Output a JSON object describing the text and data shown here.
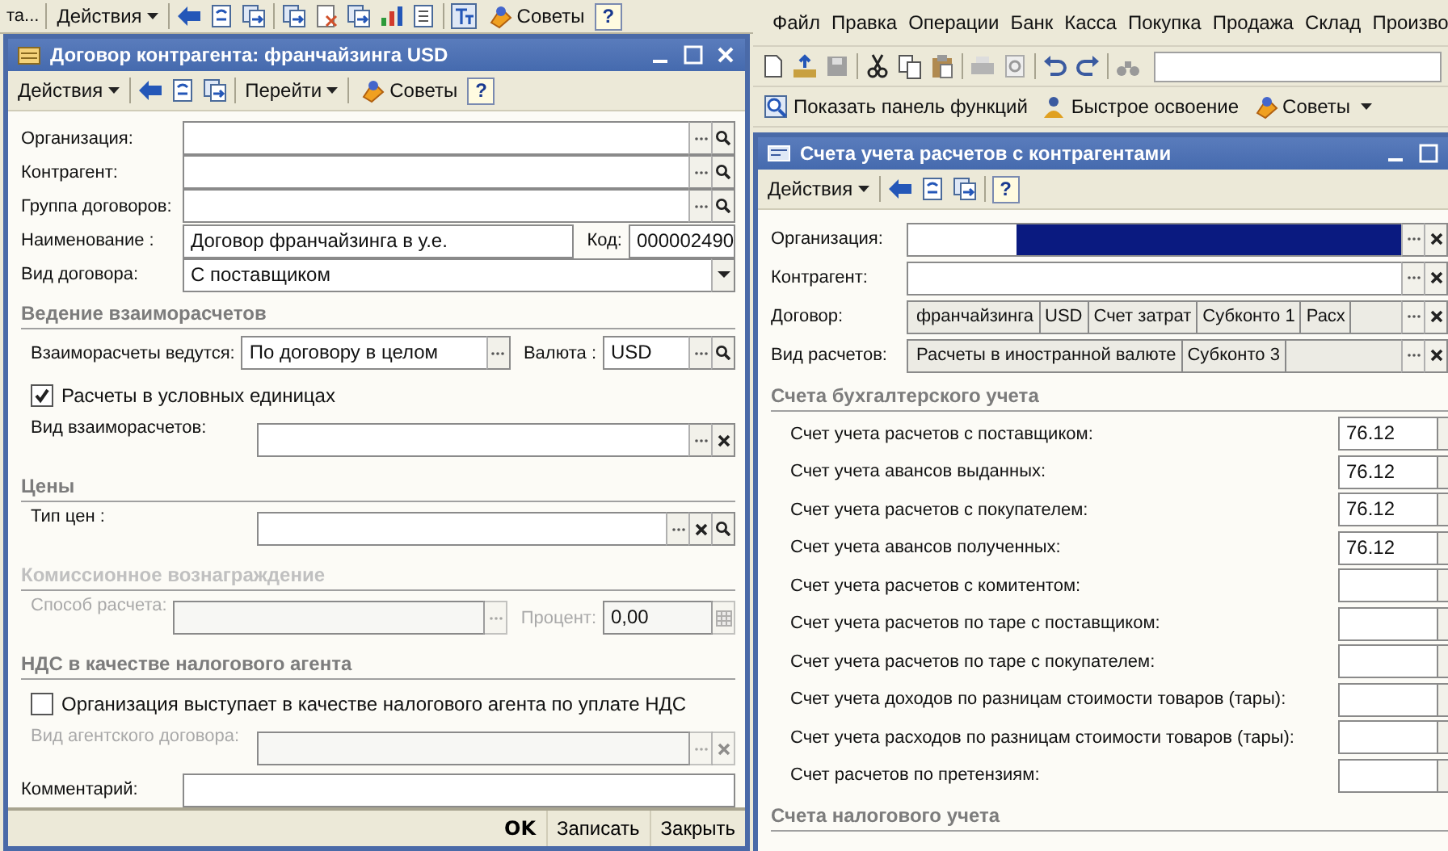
{
  "back_toolbar": {
    "cut_label": "та...",
    "actions": "Действия",
    "tips": "Советы",
    "help": "?"
  },
  "left_window": {
    "title": "Договор контрагента: франчайзинга USD",
    "toolbar": {
      "actions": "Действия",
      "goto": "Перейти",
      "tips": "Советы",
      "help": "?"
    },
    "form": [
      {
        "kind": "field",
        "label": "Организация:",
        "disabled": false,
        "select": true,
        "search": true
      },
      {
        "kind": "field",
        "label": "Контрагент:",
        "disabled": false,
        "select": true,
        "search": true
      },
      {
        "kind": "field",
        "label": "Группа договоров:",
        "disabled": false,
        "select": true,
        "search": true
      },
      {
        "kind": "code",
        "label": "Наименование :",
        "value": "Договор франчайзинга в у.е.",
        "disabled": false,
        "code_label": "Код:",
        "code": "000002490"
      },
      {
        "kind": "field",
        "label": "Вид договора:",
        "value": "С поставщиком",
        "disabled": false,
        "dropdown": true
      },
      {
        "kind": "section",
        "title": "Ведение взаиморасчетов",
        "disabled": false,
        "rows": [
          {
            "kind": "pair",
            "label": "Взаиморасчеты ведутся:",
            "value": "По договору в целом",
            "select": true,
            "disabled": false,
            "second": {
              "label": "Валюта :",
              "value": "USD",
              "select": true,
              "search": true
            }
          },
          {
            "kind": "checkbox",
            "label": "Расчеты в условных единицах",
            "checked": true,
            "disabled": false
          },
          {
            "kind": "field",
            "label": "Вид взаиморасчетов:",
            "disabled": false,
            "select": true,
            "clear": true
          }
        ]
      },
      {
        "kind": "section",
        "title": "Цены",
        "disabled": false,
        "rows": [
          {
            "kind": "field",
            "label": "Тип цен :",
            "disabled": false,
            "select": true,
            "clear": true,
            "search": true
          }
        ]
      },
      {
        "kind": "section",
        "title": "Комиссионное вознаграждение",
        "disabled": true,
        "rows": [
          {
            "kind": "pair",
            "label": "Способ расчета:",
            "select": true,
            "disabled": true,
            "second": {
              "label": "Процент:",
              "value": "0,00",
              "calculator": true
            }
          }
        ]
      },
      {
        "kind": "section",
        "title": "НДС в качестве налогового агента",
        "disabled": false,
        "rows": [
          {
            "kind": "checkbox",
            "label": "Организация выступает в качестве налогового агента по уплате НДС",
            "checked": false,
            "disabled": false
          },
          {
            "kind": "field",
            "label": "Вид агентского договора:",
            "disabled": true,
            "select": true,
            "clear": true
          }
        ]
      },
      {
        "kind": "field",
        "label": "Комментарий:",
        "disabled": false
      }
    ],
    "buttons": [
      {
        "label": "OK",
        "default": true
      },
      {
        "label": "Записать",
        "default": false
      },
      {
        "label": "Закрыть",
        "default": false
      }
    ]
  },
  "main_menu": [
    "Файл",
    "Правка",
    "Операции",
    "Банк",
    "Касса",
    "Покупка",
    "Продажа",
    "Склад",
    "Произво"
  ],
  "quick_toolbar": [
    "Показать панель функций",
    "Быстрое освоение",
    "Советы"
  ],
  "right_window": {
    "title": "Счета учета расчетов с контрагентами",
    "toolbar": {
      "actions": "Действия",
      "help": "?"
    },
    "fields": [
      {
        "label": "Организация:",
        "selected": true
      },
      {
        "label": "Контрагент:",
        "selected": false
      },
      {
        "label": "Договор:",
        "cells": [
          "франчайзинга",
          "USD",
          "Счет затрат",
          "Субконто 1",
          "Расх"
        ],
        "selected": false
      },
      {
        "label": "Вид расчетов:",
        "cells": [
          "Расчеты в иностранной валюте",
          "Субконто 3"
        ],
        "selected": false
      }
    ],
    "sections": [
      {
        "title": "Счета бухгалтерского учета",
        "rows": [
          {
            "label": "Счет учета расчетов с поставщиком:",
            "value": "76.12"
          },
          {
            "label": "Счет учета авансов выданных:",
            "value": "76.12"
          },
          {
            "label": "Счет учета расчетов с покупателем:",
            "value": "76.12"
          },
          {
            "label": "Счет учета авансов полученных:",
            "value": "76.12"
          },
          {
            "label": "Счет учета расчетов с комитентом:",
            "value": ""
          },
          {
            "label": "Счет учета расчетов по таре с поставщиком:",
            "value": ""
          },
          {
            "label": "Счет учета расчетов по таре с покупателем:",
            "value": ""
          },
          {
            "label": "Счет учета доходов по разницам стоимости товаров (тары):",
            "value": ""
          },
          {
            "label": "Счет учета расходов по разницам стоимости товаров (тары):",
            "value": ""
          },
          {
            "label": "Счет расчетов по претензиям:",
            "value": ""
          }
        ]
      },
      {
        "title": "Счета налогового учета"
      }
    ]
  }
}
